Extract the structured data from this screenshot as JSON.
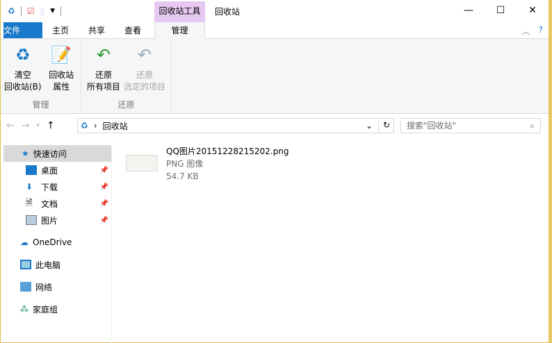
{
  "window": {
    "context_tab": "回收站工具",
    "title": "回收站"
  },
  "tabs": {
    "file": "文件",
    "home": "主页",
    "share": "共享",
    "view": "查看",
    "manage": "管理"
  },
  "ribbon": {
    "manage_group": "管理",
    "restore_group": "还原",
    "empty_line1": "清空",
    "empty_line2": "回收站(B)",
    "props_line1": "回收站",
    "props_line2": "属性",
    "restore_all_line1": "还原",
    "restore_all_line2": "所有项目",
    "restore_sel_line1": "还原",
    "restore_sel_line2": "选定的项目"
  },
  "address": {
    "path": "回收站",
    "search_placeholder": "搜索\"回收站\""
  },
  "sidebar": {
    "quick": "快速访问",
    "items": [
      {
        "label": "桌面"
      },
      {
        "label": "下载"
      },
      {
        "label": "文档"
      },
      {
        "label": "图片"
      }
    ],
    "onedrive": "OneDrive",
    "pc": "此电脑",
    "network": "网络",
    "homegroup": "家庭组"
  },
  "files": [
    {
      "name": "QQ图片20151228215202.png",
      "type": "PNG 图像",
      "size": "54.7 KB"
    }
  ],
  "colors": {
    "file_tab": "#1979ca",
    "context": "#e6c8f0"
  }
}
